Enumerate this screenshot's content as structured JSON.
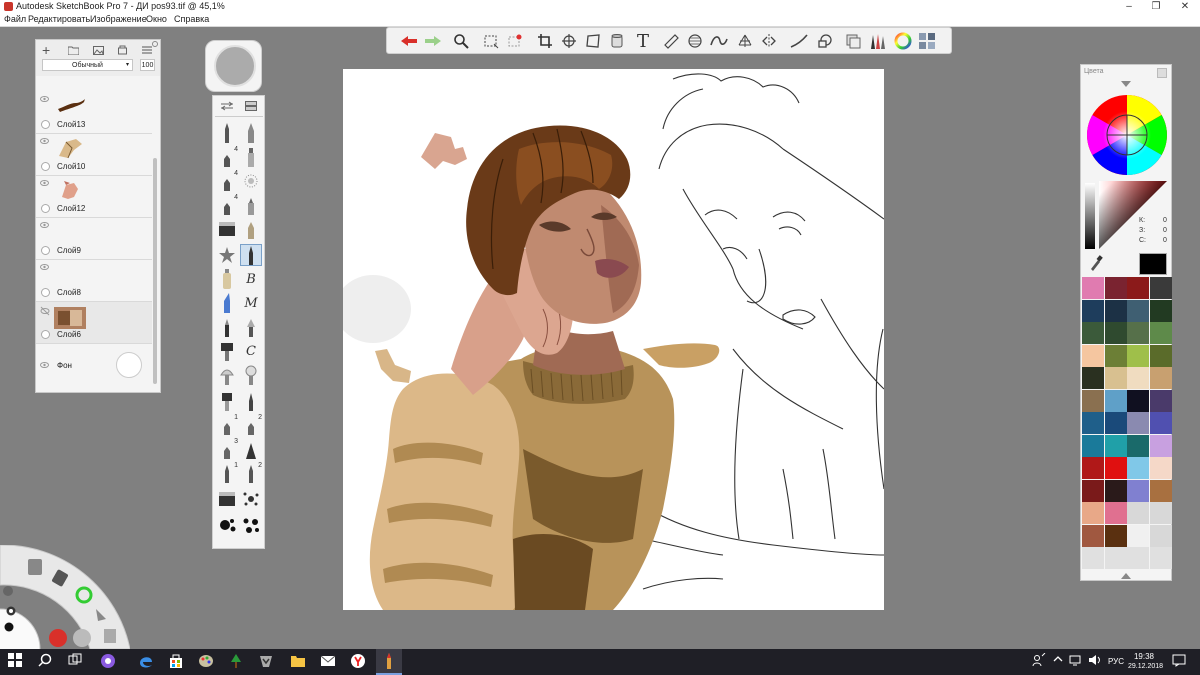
{
  "window": {
    "title": "Autodesk SketchBook Pro 7 - ДИ pos93.tif @ 45,1%",
    "minimize": "–",
    "maximize": "❐",
    "close": "✕"
  },
  "menu": [
    "Файл",
    "Редактировать",
    "Изображение",
    "Окно",
    "Справка"
  ],
  "layers_panel": {
    "blend_mode": "Обычный",
    "opacity": "100",
    "layers": [
      {
        "name": "Слой13"
      },
      {
        "name": "Слой10"
      },
      {
        "name": "Слой12"
      },
      {
        "name": "Слой9"
      },
      {
        "name": "Слой8"
      },
      {
        "name": "Слой6"
      },
      {
        "name": "Фон"
      }
    ]
  },
  "brushes": {
    "labels": [
      "4",
      "4",
      "4",
      "B",
      "M",
      "C",
      "1",
      "2",
      "3",
      "1",
      "2"
    ]
  },
  "color_panel": {
    "title": "Цвета",
    "k_label": "К:",
    "k_value": "0",
    "z_label": "З:",
    "z_value": "0",
    "c_label": "С:",
    "c_value": "0",
    "current_color": "#000000",
    "swatches": [
      "#e07bb0",
      "#7a2330",
      "#8b1a1a",
      "#3a3a3a",
      "#1e3d5c",
      "#1c3145",
      "#3f5f72",
      "#223a22",
      "#3b5a3a",
      "#2f4a2f",
      "#56704a",
      "#5e8a4a",
      "#f5c6a0",
      "#6c7f36",
      "#9fbf4a",
      "#5a6b2a",
      "#2a3020",
      "#d8c090",
      "#f0dcc0",
      "#c8a070",
      "#8a7050",
      "#5fa0c8",
      "#101020",
      "#4a3a6a",
      "#1f5f8a",
      "#1a4a7a",
      "#8a8ab0",
      "#5050b0",
      "#1a7a9a",
      "#20a0a8",
      "#1a6a6a",
      "#c8a0e0",
      "#b01818",
      "#e01010",
      "#80c8e8",
      "#f5d8c8",
      "#7a1a1a",
      "#2a1a1a",
      "#8080d0",
      "#a87040",
      "#e8a888",
      "#e07090",
      "#d8d8d8",
      "#d8d8d8",
      "#a05840",
      "#5a3010",
      "#f0f0f0",
      "#d8d8d8",
      "#e0e0e0",
      "#e0e0e0",
      "#e0e0e0",
      "#e0e0e0"
    ]
  },
  "taskbar": {
    "language": "РУС",
    "time": "19:38",
    "date": "29.12.2018"
  }
}
